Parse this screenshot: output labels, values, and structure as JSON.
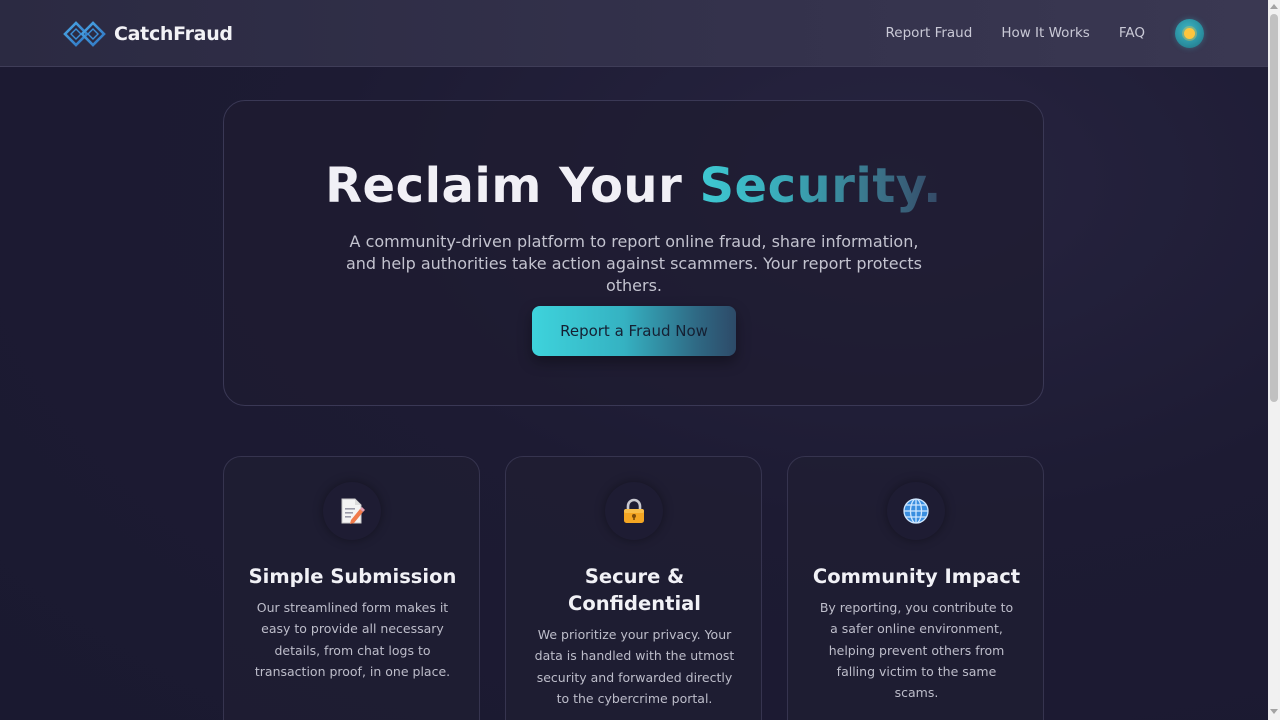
{
  "nav": {
    "brand": "CatchFraud",
    "links": [
      "Report Fraud",
      "How It Works",
      "FAQ"
    ]
  },
  "hero": {
    "title_main": "Reclaim Your ",
    "title_accent": "Security.",
    "subtitle": "A community-driven platform to report online fraud, share information, and help authorities take action against scammers. Your report protects others.",
    "cta_label": "Report a Fraud Now"
  },
  "features": [
    {
      "icon": "memo-icon",
      "title": "Simple Submission",
      "description": "Our streamlined form makes it easy to provide all necessary details, from chat logs to transaction proof, in one place."
    },
    {
      "icon": "lock-icon",
      "title": "Secure & Confidential",
      "description": "We prioritize your privacy. Your data is handled with the utmost security and forwarded directly to the cybercrime portal."
    },
    {
      "icon": "globe-icon",
      "title": "Community Impact",
      "description": "By reporting, you contribute to a safer online environment, helping prevent others from falling victim to the same scams."
    }
  ],
  "colors": {
    "accent": "#3ec9d3",
    "background": "#1d1b33",
    "navbar": "#2b2a42"
  }
}
